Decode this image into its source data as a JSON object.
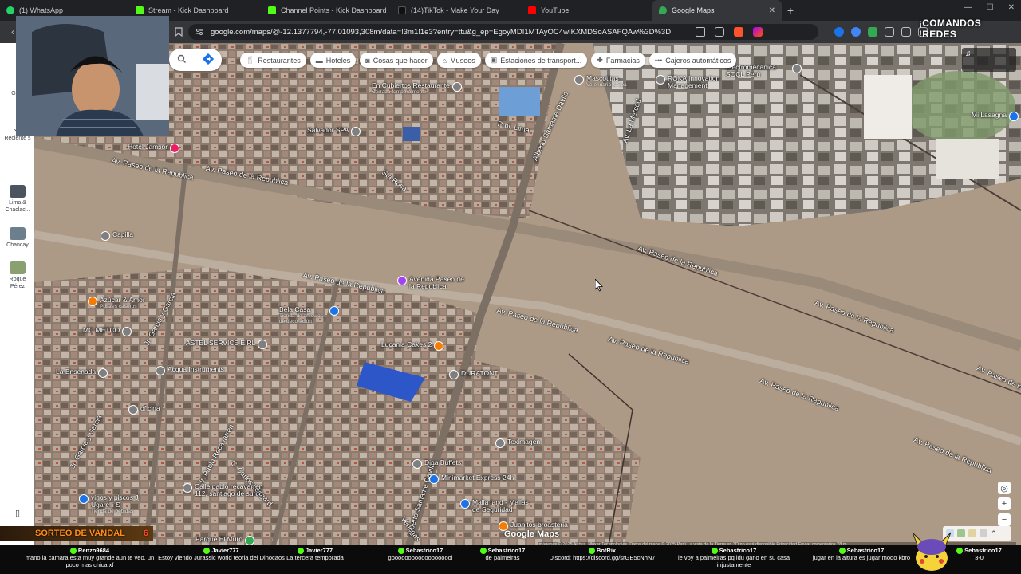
{
  "browser": {
    "tabs": [
      {
        "title": "(1) WhatsApp",
        "fav_color": "#25d366",
        "active": false
      },
      {
        "title": "Stream - Kick Dashboard",
        "fav_color": "#53fc18",
        "active": false
      },
      {
        "title": "Channel Points - Kick Dashboard",
        "fav_color": "#53fc18",
        "active": false
      },
      {
        "title": "(14)TikTok - Make Your Day",
        "fav_color": "#111111",
        "active": false
      },
      {
        "title": "YouTube",
        "fav_color": "#ff0000",
        "active": false
      },
      {
        "title": "Google Maps",
        "fav_color": "#34a853",
        "active": true
      }
    ],
    "new_tab_glyph": "+",
    "url": "google.com/maps/@-12.1377794,-77.01093,308m/data=!3m1!1e3?entry=ttu&g_ep=EgoyMDI1MTAyOC4wIKXMDSoASAFQAw%3D%3D"
  },
  "overlay": {
    "brand": "¡COMANDOS !REDES",
    "sorteo_label": "SORTEO DE VANDAL",
    "sorteo_count": "6",
    "chat": [
      {
        "user": "Renzo9684",
        "text": "mano la camara esta muy grande aun te veo, un poco mas chica xf"
      },
      {
        "user": "Javier777",
        "text": "Estoy viendo Jurassic world teoria del Dinocaos"
      },
      {
        "user": "Javier777",
        "text": "La tercera temporada"
      },
      {
        "user": "Sebastrico17",
        "text": "gooooooooooooooooool"
      },
      {
        "user": "Sebastrico17",
        "text": "de palmeiras"
      },
      {
        "user": "BotRix",
        "text": "Discord: https://discord.gg/srGE5cNhN7"
      },
      {
        "user": "Sebastrico17",
        "text": "le voy a palmeiras pq ldu gano en su casa injustamente"
      },
      {
        "user": "Sebastrico17",
        "text": "jugar en la altura es jugar modo kbro"
      },
      {
        "user": "Sebastrico17",
        "text": "3-0"
      }
    ]
  },
  "rail": {
    "items": [
      {
        "label": "Guar",
        "icon": "bookmark-icon"
      },
      {
        "label": "Reciente s",
        "icon": "history-icon"
      },
      {
        "label": "Lima & Chaclac...",
        "icon": "place-thumb"
      },
      {
        "label": "Chancay",
        "icon": "place-thumb"
      },
      {
        "label": "Roque Pérez",
        "icon": "place-thumb"
      }
    ]
  },
  "map": {
    "chips": [
      {
        "label": "Restaurantes",
        "icon": "fork-knife-icon"
      },
      {
        "label": "Hoteles",
        "icon": "bed-icon"
      },
      {
        "label": "Cosas que hacer",
        "icon": "camera-icon"
      },
      {
        "label": "Museos",
        "icon": "museum-icon"
      },
      {
        "label": "Estaciones de transport...",
        "icon": "train-icon"
      },
      {
        "label": "Farmacias",
        "icon": "pharmacy-icon"
      },
      {
        "label": "Cajeros automáticos",
        "icon": "atm-icon"
      }
    ],
    "streets": [
      "Av. Paseo de la Republica",
      "Av. Paseo de la Republica",
      "Av. Paseo de la Republica",
      "Av. Paseo de la Republica",
      "Av. Paseo de la Republica",
      "Av. Paseo de la Republica",
      "Av. Paseo de la Republica",
      "Av. Paseo de la Republica",
      "Av. Paseo de la Republica",
      "Av. Paseo de la Republica",
      "Alberto Samame Davila",
      "Alberto Samame Davila",
      "Prol. Lima",
      "Sta Rosa",
      "Jr. Garcia y Garcia",
      "Jr. Garcia y Garcia",
      "Jr. Pablo Recavarren",
      "C. Carlos Ledgard",
      "Av. La Merced",
      "Venegas"
    ],
    "pois": [
      {
        "name": "Hotel Jamsor",
        "sub": "",
        "color": "#e91e63"
      },
      {
        "name": "Salvador SPA",
        "sub": "",
        "color": "#7f7f7f"
      },
      {
        "name": "En Cubiertos Restaurante",
        "sub": "Cerrado temporalmente",
        "color": "#7f7f7f"
      },
      {
        "name": "Mascotitas",
        "sub": "Veterinaria & Spa",
        "color": "#7f7f7f"
      },
      {
        "name": "ROKA Innovation Management",
        "sub": "",
        "color": "#7f7f7f"
      },
      {
        "name": "Electromecánica SOCL Perú",
        "sub": "",
        "color": "#7f7f7f"
      },
      {
        "name": "Capilla",
        "sub": "",
        "color": "#7f7f7f"
      },
      {
        "name": "Azúcar & Amor",
        "sub": "Postres caseros",
        "color": "#f57c00"
      },
      {
        "name": "Avenida Paseo de la Republica",
        "sub": "",
        "color": "#a142f4"
      },
      {
        "name": "Bela Casa",
        "sub": "Tienda de artículos de decoración",
        "color": "#1a73e8"
      },
      {
        "name": "MC METCO",
        "sub": "",
        "color": "#7f7f7f"
      },
      {
        "name": "ASTEL SERVICE EIRL",
        "sub": "",
        "color": "#7f7f7f"
      },
      {
        "name": "Lucania Cakes 2",
        "sub": "",
        "color": "#f57c00"
      },
      {
        "name": "La Ensenada",
        "sub": "",
        "color": "#7f7f7f"
      },
      {
        "name": "Acqua Instruments",
        "sub": "",
        "color": "#7f7f7f"
      },
      {
        "name": "DURATONT",
        "sub": "",
        "color": "#7f7f7f"
      },
      {
        "name": "oficina",
        "sub": "",
        "color": "#7f7f7f"
      },
      {
        "name": "Teximagen",
        "sub": "",
        "color": "#7f7f7f"
      },
      {
        "name": "Dina Buffets",
        "sub": "",
        "color": "#7f7f7f"
      },
      {
        "name": "Minimarket Express 24h",
        "sub": "",
        "color": "#1a73e8"
      },
      {
        "name": "Malla land - Mallas de Seguridad",
        "sub": "",
        "color": "#1a73e8"
      },
      {
        "name": "vinos y piscos J Ugarelli S",
        "sub": "Tienda de bebidas",
        "color": "#1a73e8"
      },
      {
        "name": "Calle pablo recavarren 112, santiago de surco",
        "sub": "",
        "color": "#7f7f7f"
      },
      {
        "name": "Parque El Muro",
        "sub": "",
        "color": "#34a853"
      },
      {
        "name": "Juanitos broasteria",
        "sub": "",
        "color": "#f57c00"
      },
      {
        "name": "Mi Lasagna",
        "sub": "",
        "color": "#1a73e8"
      }
    ],
    "logo": "Google Maps",
    "attribution": "Imágenes © 2025 Airbus, Maxar Technologies, Datos del mapa © 2025   Perú   La vista de la Tierra en 3D no está disponible   Privacidad   Enviar comentarios   28 m"
  }
}
